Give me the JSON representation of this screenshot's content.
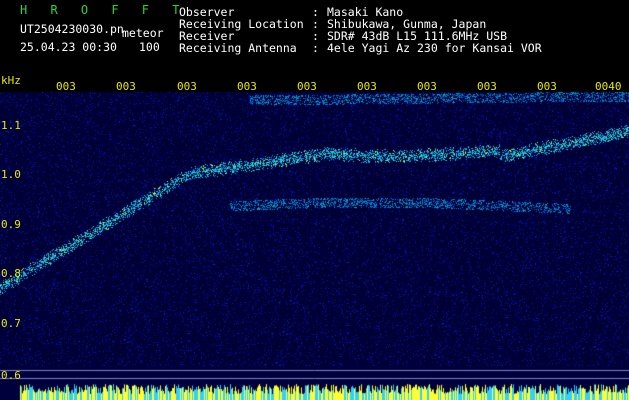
{
  "header": {
    "app_name": "H R O F F T",
    "filename": "UT2504230030.pn",
    "mode": "meteor",
    "datetime": "25.04.23 00:30",
    "level": "100",
    "fields": [
      {
        "label": "Observer",
        "sep": ":",
        "value": "Masaki Kano"
      },
      {
        "label": "Receiving Location",
        "sep": ":",
        "value": "Shibukawa, Gunma, Japan"
      },
      {
        "label": "Receiver",
        "sep": ":",
        "value": "SDR# 43dB L15 111.6MHz USB"
      },
      {
        "label": "Receiving Antenna",
        "sep": ":",
        "value": "4ele Yagi Az 230 for Kansai VOR"
      }
    ]
  },
  "spectrogram": {
    "y_unit": "kHz",
    "y_ticks": [
      "1.1",
      "1.0",
      "0.9",
      "0.8",
      "0.7",
      "0.6"
    ],
    "x_ticks": [
      "003",
      "003",
      "003",
      "003",
      "003",
      "003",
      "003",
      "003",
      "003",
      "0040"
    ],
    "colors": {
      "background": "#00003c",
      "text": "#e8e800",
      "trace": "#00c8ff",
      "hot": "#ffff40"
    }
  }
}
